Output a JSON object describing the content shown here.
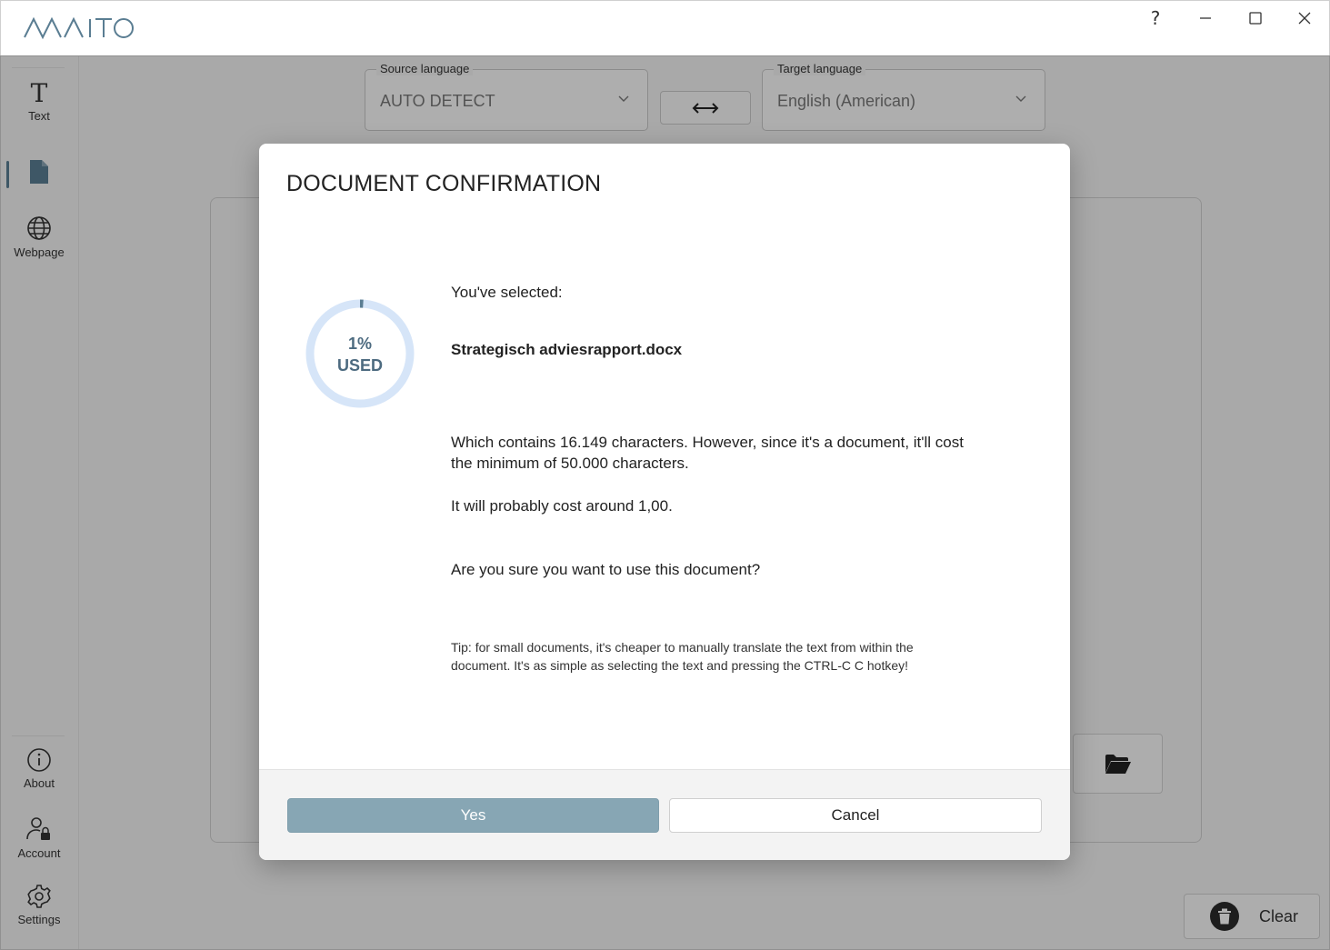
{
  "app": {
    "logo_text": "MAITO",
    "accent_color": "#5a7d92"
  },
  "window_controls": {
    "help": "?"
  },
  "sidebar": {
    "top_items": [
      {
        "label": "Text",
        "icon": "text-icon"
      },
      {
        "label": "",
        "icon": "document-icon",
        "active": true
      },
      {
        "label": "Webpage",
        "icon": "globe-icon"
      }
    ],
    "bottom_items": [
      {
        "label": "About",
        "icon": "info-icon"
      },
      {
        "label": "Account",
        "icon": "account-lock-icon"
      },
      {
        "label": "Settings",
        "icon": "gear-icon"
      }
    ]
  },
  "languages": {
    "source_label": "Source language",
    "source_value": "AUTO DETECT",
    "target_label": "Target language",
    "target_value": "English (American)"
  },
  "toolbar": {
    "clear_label": "Clear"
  },
  "dialog": {
    "title": "DOCUMENT CONFIRMATION",
    "usage_percent": "1%",
    "usage_label": "USED",
    "usage_fraction": 0.01,
    "selected_label": "You've selected:",
    "file_name": "Strategisch adviesrapport.docx",
    "contains_text": "Which contains 16.149 characters. However, since it's a document, it'll cost the minimum of 50.000 characters.",
    "cost_text": "It will probably cost around 1,00.",
    "question": "Are you sure you want to use this document?",
    "tip": "Tip: for small documents, it's cheaper to manually translate the text from within the document. It's as simple as selecting the text and pressing the CTRL-C C hotkey!",
    "yes_label": "Yes",
    "cancel_label": "Cancel"
  }
}
